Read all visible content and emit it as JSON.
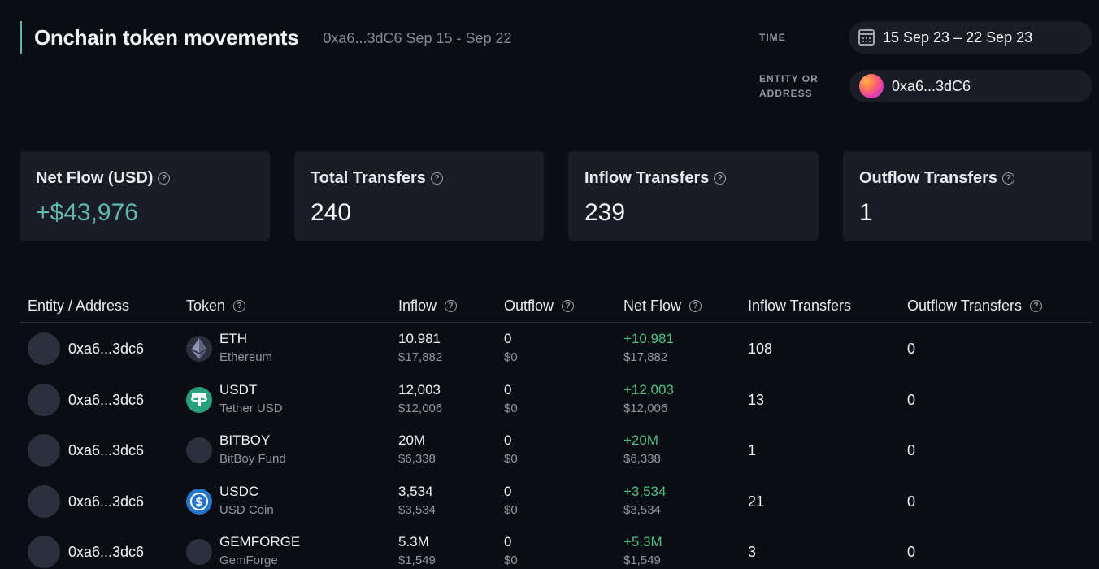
{
  "header": {
    "title": "Onchain token movements",
    "subtitle": "0xa6...3dC6 Sep 15 - Sep 22"
  },
  "filters": {
    "time_label": "TIME",
    "time_value": "15 Sep 23 – 22 Sep 23",
    "entity_label_line1": "ENTITY OR",
    "entity_label_line2": "ADDRESS",
    "entity_value": "0xa6...3dC6"
  },
  "stats": [
    {
      "label": "Net Flow (USD)",
      "value": "+$43,976"
    },
    {
      "label": "Total Transfers",
      "value": "240"
    },
    {
      "label": "Inflow Transfers",
      "value": "239"
    },
    {
      "label": "Outflow Transfers",
      "value": "1"
    }
  ],
  "table": {
    "columns": {
      "entity": "Entity / Address",
      "token": "Token",
      "inflow": "Inflow",
      "outflow": "Outflow",
      "netflow": "Net Flow",
      "inflow_transfers": "Inflow Transfers",
      "outflow_transfers": "Outflow Transfers"
    },
    "rows": [
      {
        "entity": "0xa6...3dc6",
        "symbol": "ETH",
        "name": "Ethereum",
        "icon": "ethereum-icon",
        "inflow": "10.981",
        "inflow_usd": "$17,882",
        "outflow": "0",
        "outflow_usd": "$0",
        "netflow": "+10.981",
        "netflow_usd": "$17,882",
        "inflow_transfers": "108",
        "outflow_transfers": "0"
      },
      {
        "entity": "0xa6...3dc6",
        "symbol": "USDT",
        "name": "Tether USD",
        "icon": "tether-icon",
        "inflow": "12,003",
        "inflow_usd": "$12,006",
        "outflow": "0",
        "outflow_usd": "$0",
        "netflow": "+12,003",
        "netflow_usd": "$12,006",
        "inflow_transfers": "13",
        "outflow_transfers": "0"
      },
      {
        "entity": "0xa6...3dc6",
        "symbol": "BITBOY",
        "name": "BitBoy Fund",
        "icon": "token-placeholder-icon",
        "inflow": "20M",
        "inflow_usd": "$6,338",
        "outflow": "0",
        "outflow_usd": "$0",
        "netflow": "+20M",
        "netflow_usd": "$6,338",
        "inflow_transfers": "1",
        "outflow_transfers": "0"
      },
      {
        "entity": "0xa6...3dc6",
        "symbol": "USDC",
        "name": "USD Coin",
        "icon": "usdc-icon",
        "inflow": "3,534",
        "inflow_usd": "$3,534",
        "outflow": "0",
        "outflow_usd": "$0",
        "netflow": "+3,534",
        "netflow_usd": "$3,534",
        "inflow_transfers": "21",
        "outflow_transfers": "0"
      },
      {
        "entity": "0xa6...3dc6",
        "symbol": "GEMFORGE",
        "name": "GemForge",
        "icon": "token-placeholder-icon",
        "inflow": "5.3M",
        "inflow_usd": "$1,549",
        "outflow": "0",
        "outflow_usd": "$0",
        "netflow": "+5.3M",
        "netflow_usd": "$1,549",
        "inflow_transfers": "3",
        "outflow_transfers": "0"
      }
    ]
  },
  "colors": {
    "background": "#0b0d14",
    "card": "#1a1d25",
    "accent": "#5fb8b0",
    "positive": "#4fbf7f"
  }
}
